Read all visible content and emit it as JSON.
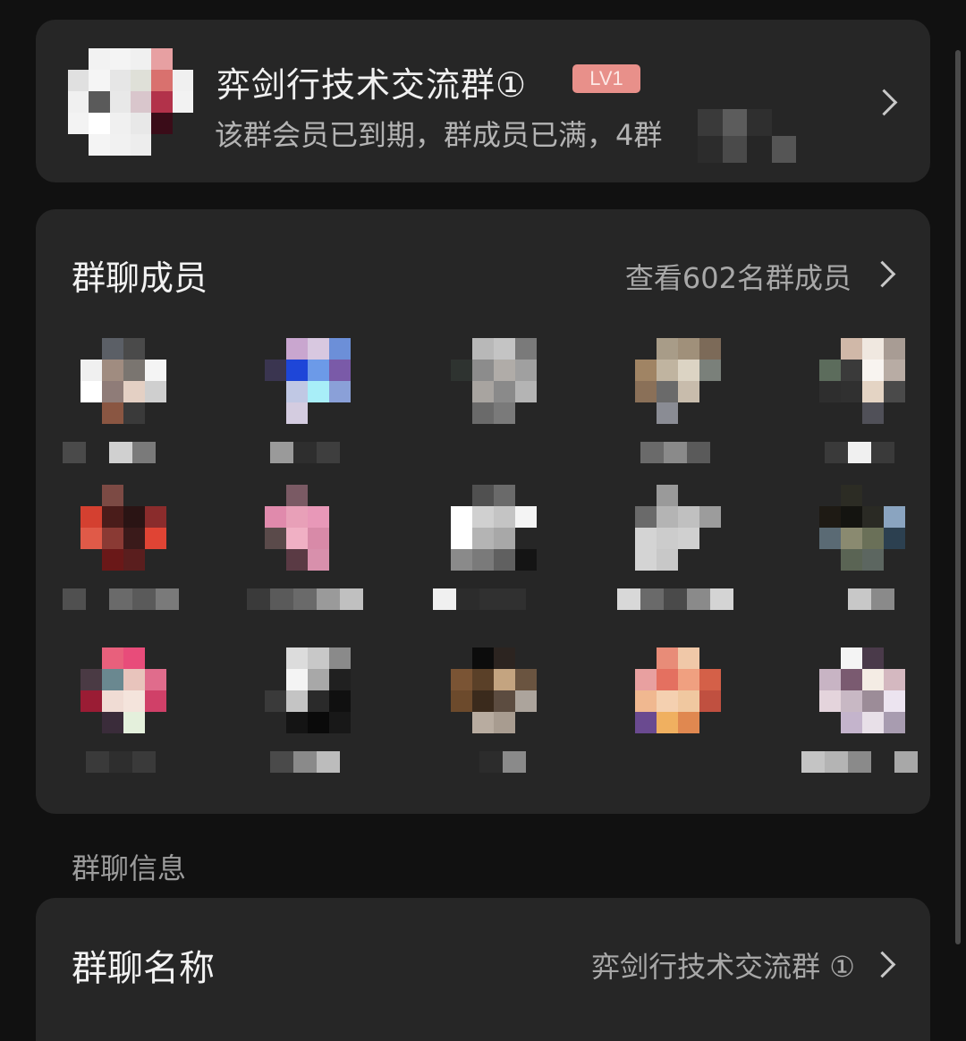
{
  "group": {
    "name": "弈剑行技术交流群①",
    "level_badge": "LV1",
    "subtitle": "该群会员已到期，群成员已满，4群"
  },
  "members_section": {
    "title": "群聊成员",
    "view_all": "查看602名群成员"
  },
  "info_section": {
    "label": "群聊信息"
  },
  "name_row": {
    "title": "群聊名称",
    "value": "弈剑行技术交流群 ①"
  },
  "colors": {
    "background": "#111111",
    "card": "#262626",
    "badge": "#e8908a"
  }
}
